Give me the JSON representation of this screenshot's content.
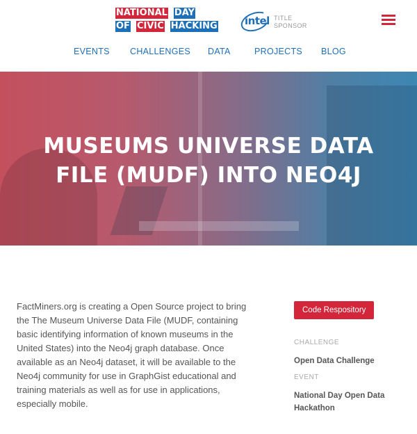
{
  "header": {
    "logo_line1": [
      "NATIONAL",
      "DAY"
    ],
    "logo_line2": [
      "OF",
      "CIVIC",
      "HACKING"
    ],
    "sponsor_brand": "intel",
    "sponsor_label_1": "TITLE",
    "sponsor_label_2": "SPONSOR"
  },
  "nav": {
    "items": [
      {
        "label": "EVENTS"
      },
      {
        "label": "CHALLENGES"
      },
      {
        "label": "DATA"
      },
      {
        "label": "PROJECTS"
      },
      {
        "label": "BLOG"
      }
    ]
  },
  "hero": {
    "title_line1": "MUSEUMS UNIVERSE DATA",
    "title_line2": "FILE (MUDF) INTO NEO4J"
  },
  "main": {
    "description": "FactMiners.org is creating a Open Source project to bring the The Museum Universe Data File (MUDF, containing basic identifying information of known museums in the United States) into the Neo4j graph database. Once available as an Neo4j dataset, it will be available to the Neo4j community for use in GraphGist educational and training materials as well as for use in applications, especially mobile."
  },
  "sidebar": {
    "button_label": "Code Respository",
    "challenge_label": "CHALLENGE",
    "challenge_value": "Open Data Challenge",
    "event_label": "EVENT",
    "event_value": "National Day Open Data Hackathon"
  },
  "colors": {
    "accent_red": "#d4263b",
    "accent_blue": "#1d6fb8"
  },
  "icons": {
    "menu": "hamburger-menu-icon"
  }
}
